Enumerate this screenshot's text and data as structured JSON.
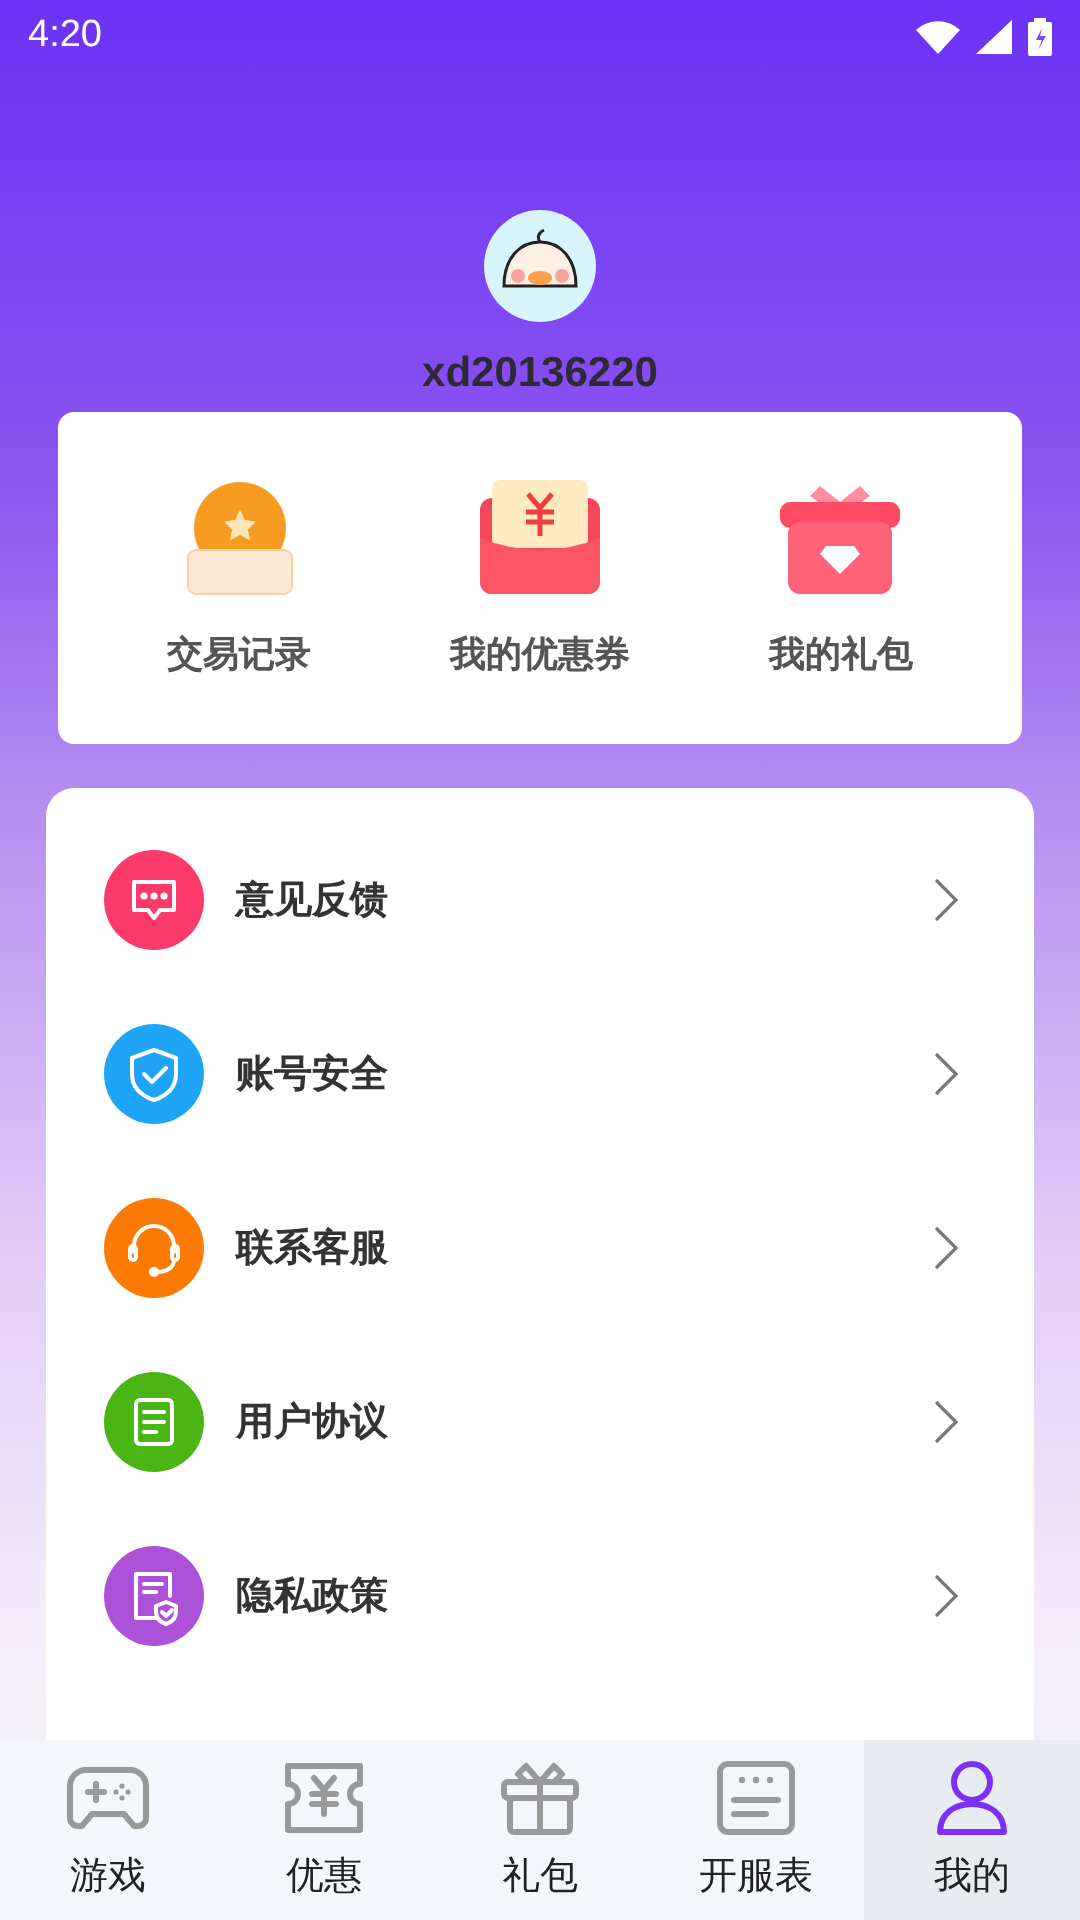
{
  "status_bar": {
    "time": "4:20"
  },
  "profile": {
    "username": "xd20136220"
  },
  "quick_actions": [
    {
      "kind": "coin",
      "label": "交易记录"
    },
    {
      "kind": "envelope",
      "label": "我的优惠券"
    },
    {
      "kind": "gift",
      "label": "我的礼包"
    }
  ],
  "menu": [
    {
      "kind": "chat",
      "label": "意见反馈",
      "color": "#fb3a6c"
    },
    {
      "kind": "shield",
      "label": "账号安全",
      "color": "#1ea5f7"
    },
    {
      "kind": "headset",
      "label": "联系客服",
      "color": "#fb7a03"
    },
    {
      "kind": "document",
      "label": "用户协议",
      "color": "#4cb516"
    },
    {
      "kind": "policy",
      "label": "隐私政策",
      "color": "#ac52d9"
    }
  ],
  "tab_bar": [
    {
      "kind": "gamepad",
      "label": "游戏",
      "selected": false
    },
    {
      "kind": "ticket",
      "label": "优惠",
      "selected": false
    },
    {
      "kind": "gift",
      "label": "礼包",
      "selected": false
    },
    {
      "kind": "schedule",
      "label": "开服表",
      "selected": false
    },
    {
      "kind": "person",
      "label": "我的",
      "selected": true
    }
  ]
}
